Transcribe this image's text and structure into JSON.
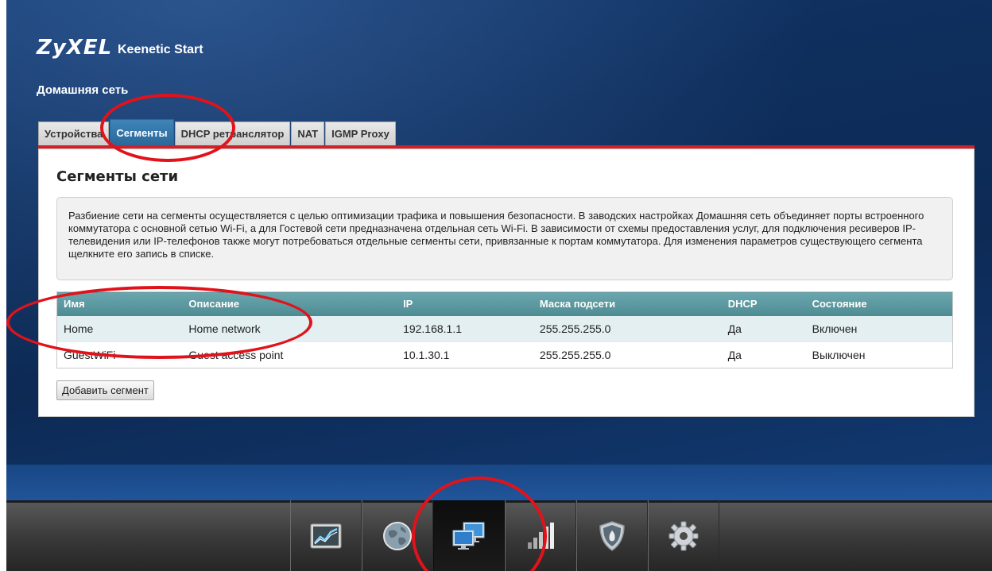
{
  "header": {
    "logo_text": "ZyXEL",
    "product_name": "Keenetic Start",
    "page_title": "Домашняя сеть"
  },
  "tabs": [
    {
      "label": "Устройства",
      "active": false
    },
    {
      "label": "Сегменты",
      "active": true
    },
    {
      "label": "DHCP ретранслятор",
      "active": false
    },
    {
      "label": "NAT",
      "active": false
    },
    {
      "label": "IGMP Proxy",
      "active": false
    }
  ],
  "panel": {
    "heading": "Сегменты сети",
    "description": "Разбиение сети на сегменты осуществляется с целью оптимизации трафика и повышения безопасности. В заводских настройках Домашняя сеть объединяет порты встроенного коммутатора с основной сетью Wi-Fi, а для Гостевой сети предназначена отдельная сеть Wi-Fi. В зависимости от схемы предоставления услуг, для подключения ресиверов IP-телевидения или IP-телефонов также могут потребоваться отдельные сегменты сети, привязанные к портам коммутатора. Для изменения параметров существующего сегмента щелкните его запись в списке."
  },
  "table": {
    "headers": [
      "Имя",
      "Описание",
      "IP",
      "Маска подсети",
      "DHCP",
      "Состояние"
    ],
    "rows": [
      [
        "Home",
        "Home network",
        "192.168.1.1",
        "255.255.255.0",
        "Да",
        "Включен"
      ],
      [
        "GuestWiFi",
        "Guest access point",
        "10.1.30.1",
        "255.255.255.0",
        "Да",
        "Выключен"
      ]
    ]
  },
  "buttons": {
    "add_segment": "Добавить сегмент"
  },
  "dock": [
    {
      "icon": "monitor-chart-icon",
      "active": false
    },
    {
      "icon": "globe-icon",
      "active": false
    },
    {
      "icon": "home-network-icon",
      "active": true
    },
    {
      "icon": "wifi-signal-icon",
      "active": false
    },
    {
      "icon": "security-shield-icon",
      "active": false
    },
    {
      "icon": "gear-icon",
      "active": false
    }
  ],
  "colors": {
    "accent_red": "#d31f26",
    "tab_active": "#2a6899",
    "table_header": "#5a959c",
    "annotation": "#e0131b"
  }
}
